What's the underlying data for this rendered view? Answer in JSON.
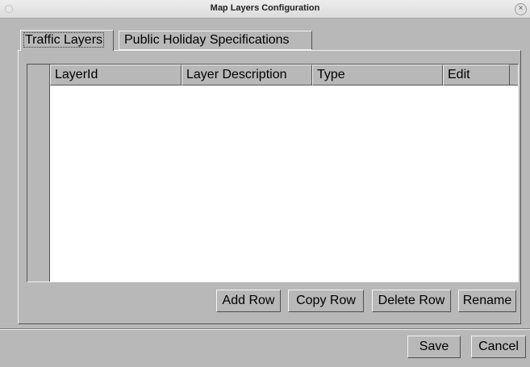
{
  "window": {
    "title": "Map Layers Configuration",
    "close_glyph": "×"
  },
  "tabs": [
    {
      "label": "Traffic Layers",
      "selected": true
    },
    {
      "label": "Public Holiday Specifications",
      "selected": false
    }
  ],
  "table": {
    "columns": [
      "LayerId",
      "Layer Description",
      "Type",
      "Edit"
    ],
    "rows": []
  },
  "table_actions": {
    "add_row": "Add Row",
    "copy_row": "Copy Row",
    "delete_row": "Delete Row",
    "rename": "Rename"
  },
  "dialog_actions": {
    "save": "Save",
    "cancel": "Cancel"
  },
  "colors": {
    "background": "#b8b8b8",
    "table_background": "#ffffff"
  }
}
